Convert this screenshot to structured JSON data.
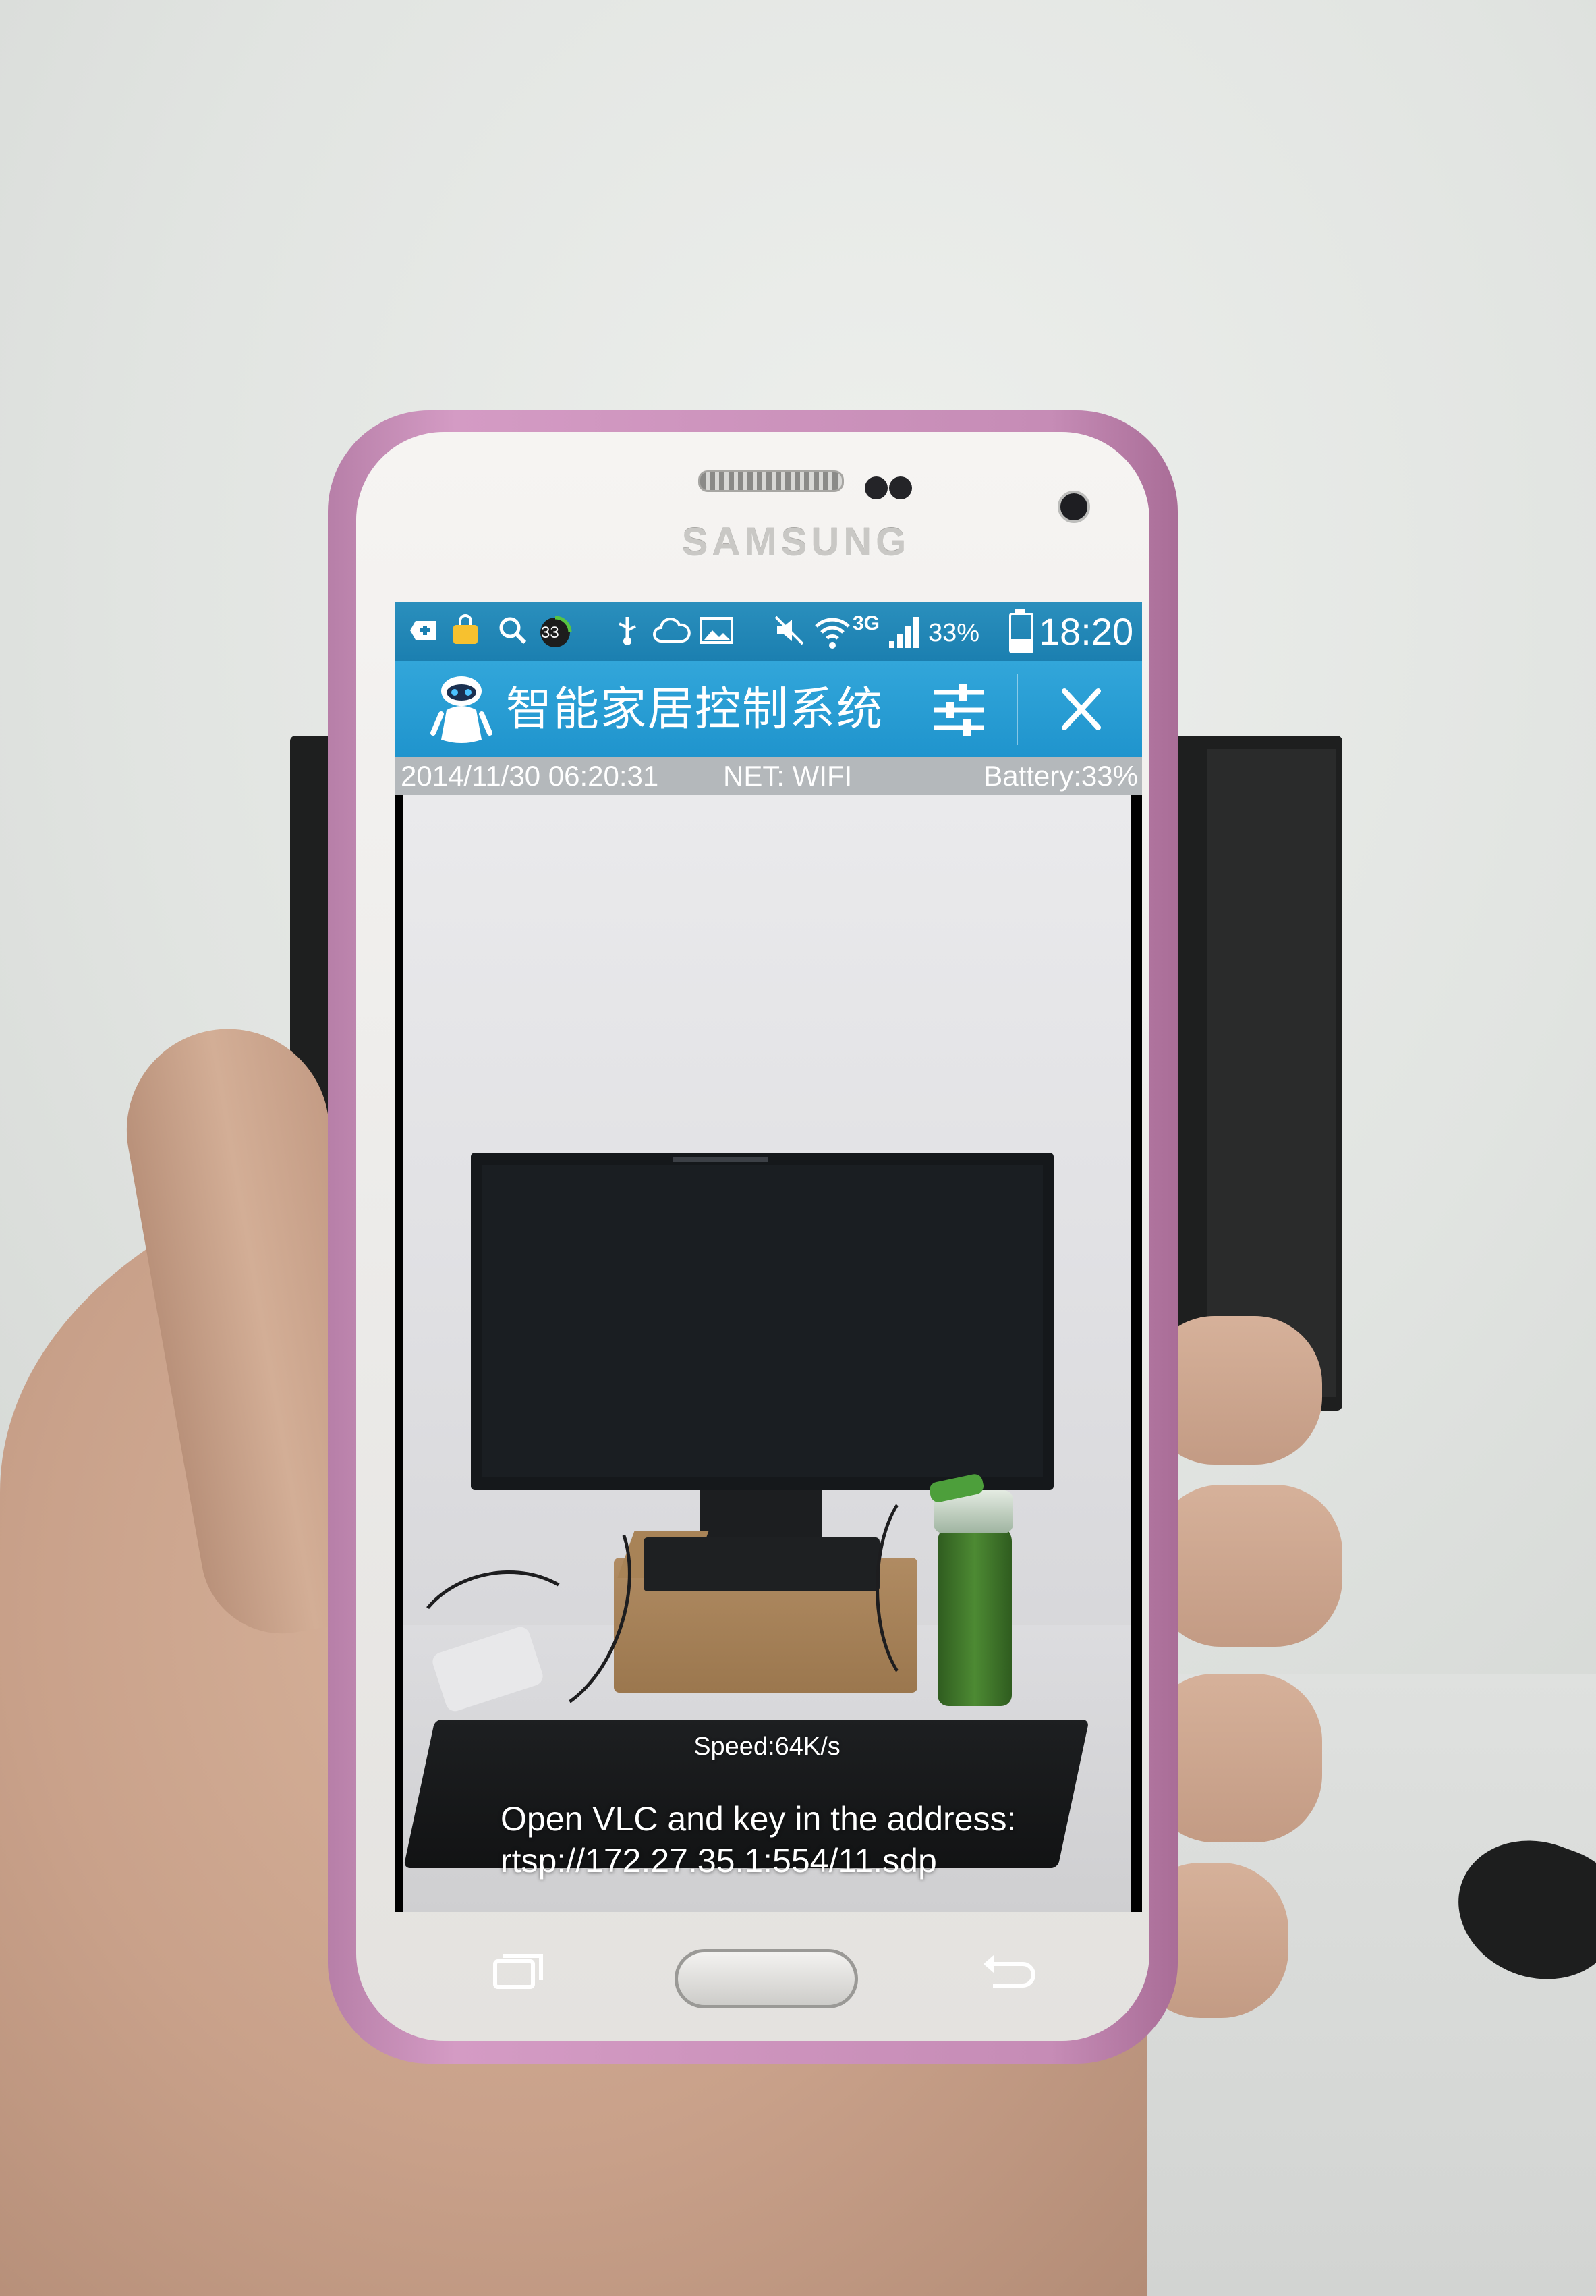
{
  "device": {
    "brand": "SAMSUNG"
  },
  "status_bar": {
    "notification_badge": "33",
    "network_type": "3G",
    "battery_percent": "33%",
    "battery_level": 0.33,
    "time": "18:20",
    "icons": [
      "add-icon",
      "bag-icon",
      "search-icon",
      "badge-icon",
      "usb-icon",
      "cloud-icon",
      "image-icon",
      "mute-icon",
      "wifi-icon",
      "signal-icon",
      "battery-icon"
    ]
  },
  "app_bar": {
    "title": "智能家居控制系统",
    "color": "#239ad2",
    "icons": [
      "robot-logo-icon",
      "sliders-icon",
      "close-icon"
    ]
  },
  "info_bar": {
    "datetime": "2014/11/30 06:20:31",
    "net": "NET: WIFI",
    "battery": "Battery:33%"
  },
  "video": {
    "speed": "Speed:64K/s",
    "instruction_line1": "Open VLC and key in the address:",
    "instruction_line2": "rtsp://172.27.35.1:554/11.sdp"
  },
  "hardware_keys": {
    "icons": [
      "recent-apps-icon",
      "home-button",
      "back-icon"
    ]
  }
}
